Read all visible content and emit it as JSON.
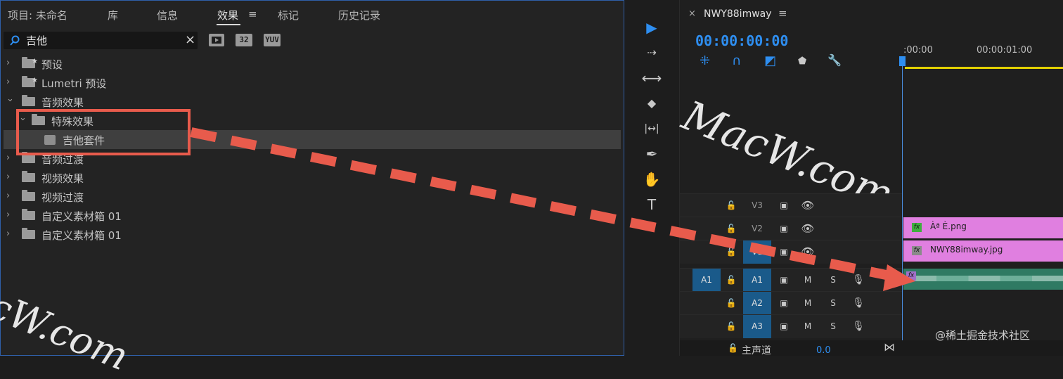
{
  "tabs": [
    {
      "label": "项目: 未命名",
      "active": false
    },
    {
      "label": "库",
      "active": false
    },
    {
      "label": "信息",
      "active": false
    },
    {
      "label": "效果",
      "active": true
    },
    {
      "label": "标记",
      "active": false
    },
    {
      "label": "历史记录",
      "active": false
    }
  ],
  "tab_menu_glyph": "≡",
  "search": {
    "value": "吉他",
    "clear": "×",
    "icon": "search-icon"
  },
  "tool_badges": [
    "32",
    "YUV"
  ],
  "tree": [
    {
      "label": "预设",
      "chevron": "›"
    },
    {
      "label": "Lumetri 预设",
      "chevron": "›"
    },
    {
      "label": "音频效果",
      "chevron": "⌄"
    },
    {
      "label": "特殊效果",
      "chevron": "⌄"
    },
    {
      "label": "吉他套件",
      "chevron": ""
    },
    {
      "label": "音频过渡",
      "chevron": "›"
    },
    {
      "label": "视频效果",
      "chevron": "›"
    },
    {
      "label": "视频过渡",
      "chevron": "›"
    },
    {
      "label": "自定义素材箱 01",
      "chevron": "›"
    },
    {
      "label": "自定义素材箱 01",
      "chevron": "›"
    }
  ],
  "watermarks": {
    "center": "MacW.com",
    "left": "cW.com"
  },
  "tools": {
    "select": "▶",
    "track_select": "⇢",
    "ripple": "⟷",
    "razor": "◆",
    "slip": "|↔|",
    "pen": "✒",
    "hand": "✋",
    "type": "T"
  },
  "sequence": {
    "close": "×",
    "name": "NWY88imway",
    "menu": "≡",
    "timecode": "00:00:00:00",
    "ruler": [
      ":00:00",
      "00:00:01:00"
    ]
  },
  "timeline_icons": {
    "snap": "⁜",
    "magnet": "∩",
    "linked": "◩",
    "marker": "⬟",
    "wrench": "🔧"
  },
  "tracks": [
    {
      "src": "",
      "lock": "🔓",
      "target": "V3",
      "target_on": false,
      "kind": "video"
    },
    {
      "src": "",
      "lock": "🔓",
      "target": "V2",
      "target_on": false,
      "kind": "video"
    },
    {
      "src": "",
      "lock": "🔓",
      "target": "V1",
      "target_on": true,
      "kind": "video"
    },
    {
      "src": "A1",
      "lock": "🔓",
      "target": "A1",
      "target_on": true,
      "kind": "audio"
    },
    {
      "src": "",
      "lock": "🔓",
      "target": "A2",
      "target_on": true,
      "kind": "audio"
    },
    {
      "src": "",
      "lock": "🔓",
      "target": "A3",
      "target_on": true,
      "kind": "audio"
    }
  ],
  "track_glyphs": {
    "cam": "▣",
    "eye": "👁",
    "m": "M",
    "s": "S",
    "mic": "🎙"
  },
  "clips": [
    {
      "name": "Àª È.png",
      "fx": "fx",
      "fx_color": "#3fae3f"
    },
    {
      "name": "NWY88imway.jpg",
      "fx": "fx",
      "fx_color": "#8a8a8a"
    }
  ],
  "audio_fx": "fx",
  "master": {
    "lock": "🔓",
    "label": "主声道",
    "value": "0.0",
    "end": "⋈"
  },
  "credit": "@稀土掘金技术社区",
  "colors": {
    "accent": "#2e8ef0",
    "highlight": "#e85b4c",
    "clip_video": "#e07fe0",
    "clip_audio": "#2f7a63",
    "workbar": "#e2d000"
  }
}
